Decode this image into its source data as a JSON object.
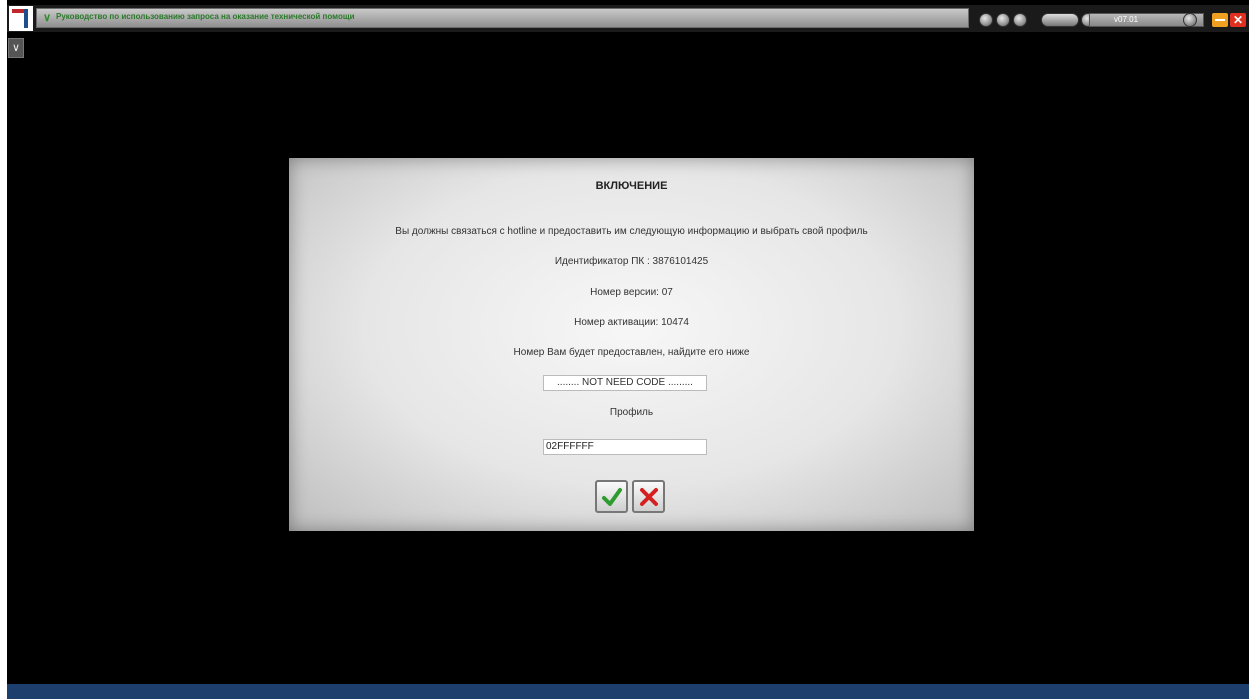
{
  "app": {
    "title": "Руководство по использованию запроса на оказание технической помощи",
    "version": "v07.01"
  },
  "dialog": {
    "title": "ВКЛЮЧЕНИЕ",
    "instruction": "Вы должны связаться с hotline и предоставить им следующую информацию и выбрать свой профиль",
    "pc_id": "Идентификатор ПК : 3876101425",
    "version_number": "Номер версии: 07",
    "activation_number": "Номер активации: 10474",
    "number_note": "Номер Вам будет предоставлен, найдите его ниже",
    "code_value": "........ NOT NEED CODE .........",
    "profile_label": "Профиль",
    "profile_value": "02FFFFFF"
  },
  "icons": [
    "logo-icon",
    "chevron-down-icon",
    "circle-control-icon",
    "checkmark-icon",
    "cross-icon",
    "minimize-icon",
    "close-icon"
  ],
  "colors": {
    "title_text": "#2a7a2a",
    "bottom_bar": "#1d3f6e",
    "ok_green": "#2e9b2e",
    "cancel_red": "#d42020"
  }
}
